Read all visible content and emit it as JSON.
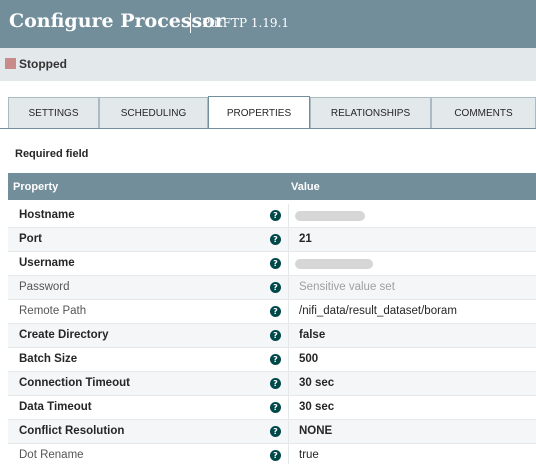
{
  "header": {
    "title": "Configure Processor",
    "subtitle": "PutFTP 1.19.1"
  },
  "status": {
    "label": "Stopped",
    "color": "#c98a8a"
  },
  "tabs": [
    {
      "label": "SETTINGS",
      "active": false
    },
    {
      "label": "SCHEDULING",
      "active": false
    },
    {
      "label": "PROPERTIES",
      "active": true
    },
    {
      "label": "RELATIONSHIPS",
      "active": false
    },
    {
      "label": "COMMENTS",
      "active": false
    }
  ],
  "required_label": "Required field",
  "table": {
    "col_property": "Property",
    "col_value": "Value",
    "rows": [
      {
        "name": "Hostname",
        "value": "",
        "required": true,
        "redacted": true
      },
      {
        "name": "Port",
        "value": "21",
        "required": true
      },
      {
        "name": "Username",
        "value": "",
        "required": true,
        "redacted": true
      },
      {
        "name": "Password",
        "value": "Sensitive value set",
        "required": false,
        "sensitive": true
      },
      {
        "name": "Remote Path",
        "value": "/nifi_data/result_dataset/boram",
        "required": false
      },
      {
        "name": "Create Directory",
        "value": "false",
        "required": true
      },
      {
        "name": "Batch Size",
        "value": "500",
        "required": true
      },
      {
        "name": "Connection Timeout",
        "value": "30 sec",
        "required": true
      },
      {
        "name": "Data Timeout",
        "value": "30 sec",
        "required": true
      },
      {
        "name": "Conflict Resolution",
        "value": "NONE",
        "required": true
      },
      {
        "name": "Dot Rename",
        "value": "true",
        "required": false
      }
    ]
  },
  "colors": {
    "header_bg": "#728e9b",
    "status_bg": "#e3e8eb",
    "help_icon": "#004849"
  }
}
